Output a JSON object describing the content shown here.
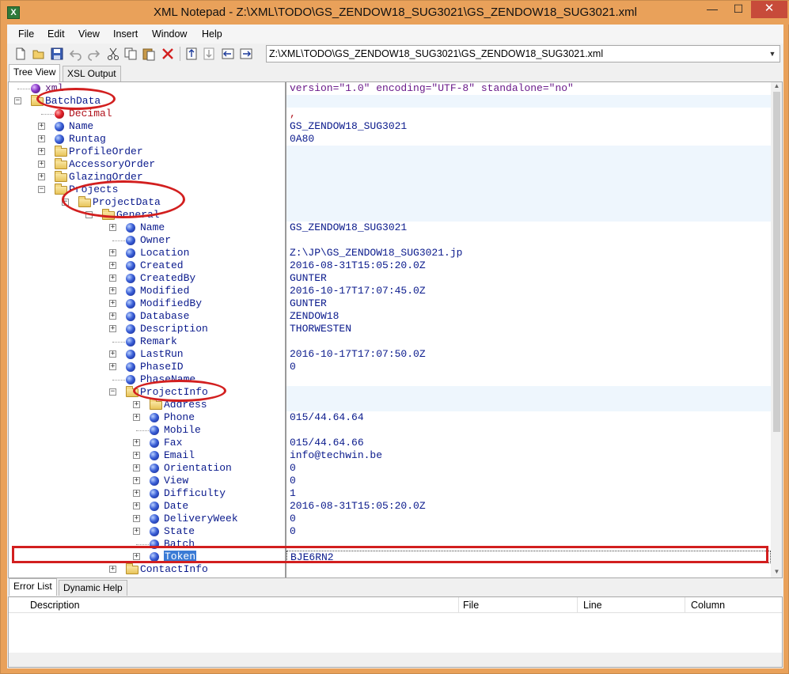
{
  "window": {
    "title": "XML Notepad - Z:\\XML\\TODO\\GS_ZENDOW18_SUG3021\\GS_ZENDOW18_SUG3021.xml",
    "icon_letter": "X",
    "minimize": "—",
    "maximize": "☐",
    "close": "✕"
  },
  "menu": [
    "File",
    "Edit",
    "View",
    "Insert",
    "Window",
    "Help"
  ],
  "toolbar": {
    "path": "Z:\\XML\\TODO\\GS_ZENDOW18_SUG3021\\GS_ZENDOW18_SUG3021.xml",
    "icons": [
      "new-file-icon",
      "open-folder-icon",
      "save-icon",
      "undo-icon",
      "redo-icon",
      "cut-icon",
      "copy-icon",
      "paste-icon",
      "delete-icon",
      "nudge-up-icon",
      "nudge-down-icon",
      "nudge-left-icon",
      "nudge-right-icon"
    ]
  },
  "tabs_top": [
    "Tree View",
    "XSL Output"
  ],
  "tree": [
    {
      "label": "xml",
      "type": "pi",
      "depth": 0,
      "expander": ""
    },
    {
      "label": "BatchData",
      "type": "folder",
      "depth": 0,
      "expander": "−"
    },
    {
      "label": "Decimal",
      "type": "attr",
      "depth": 1,
      "expander": ""
    },
    {
      "label": "Name",
      "type": "elem",
      "depth": 1,
      "expander": "+"
    },
    {
      "label": "Runtag",
      "type": "elem",
      "depth": 1,
      "expander": "+"
    },
    {
      "label": "ProfileOrder",
      "type": "folder",
      "depth": 1,
      "expander": "+"
    },
    {
      "label": "AccessoryOrder",
      "type": "folder",
      "depth": 1,
      "expander": "+"
    },
    {
      "label": "GlazingOrder",
      "type": "folder",
      "depth": 1,
      "expander": "+"
    },
    {
      "label": "Projects",
      "type": "folder",
      "depth": 1,
      "expander": "−"
    },
    {
      "label": "ProjectData",
      "type": "folder",
      "depth": 2,
      "expander": "−"
    },
    {
      "label": "General",
      "type": "folder",
      "depth": 3,
      "expander": "−"
    },
    {
      "label": "Name",
      "type": "elem",
      "depth": 4,
      "expander": "+"
    },
    {
      "label": "Owner",
      "type": "elem",
      "depth": 4,
      "expander": ""
    },
    {
      "label": "Location",
      "type": "elem",
      "depth": 4,
      "expander": "+"
    },
    {
      "label": "Created",
      "type": "elem",
      "depth": 4,
      "expander": "+"
    },
    {
      "label": "CreatedBy",
      "type": "elem",
      "depth": 4,
      "expander": "+"
    },
    {
      "label": "Modified",
      "type": "elem",
      "depth": 4,
      "expander": "+"
    },
    {
      "label": "ModifiedBy",
      "type": "elem",
      "depth": 4,
      "expander": "+"
    },
    {
      "label": "Database",
      "type": "elem",
      "depth": 4,
      "expander": "+"
    },
    {
      "label": "Description",
      "type": "elem",
      "depth": 4,
      "expander": "+"
    },
    {
      "label": "Remark",
      "type": "elem",
      "depth": 4,
      "expander": ""
    },
    {
      "label": "LastRun",
      "type": "elem",
      "depth": 4,
      "expander": "+"
    },
    {
      "label": "PhaseID",
      "type": "elem",
      "depth": 4,
      "expander": "+"
    },
    {
      "label": "PhaseName",
      "type": "elem",
      "depth": 4,
      "expander": ""
    },
    {
      "label": "ProjectInfo",
      "type": "folder",
      "depth": 4,
      "expander": "−"
    },
    {
      "label": "Address",
      "type": "folder",
      "depth": 5,
      "expander": "+"
    },
    {
      "label": "Phone",
      "type": "elem",
      "depth": 5,
      "expander": "+"
    },
    {
      "label": "Mobile",
      "type": "elem",
      "depth": 5,
      "expander": ""
    },
    {
      "label": "Fax",
      "type": "elem",
      "depth": 5,
      "expander": "+"
    },
    {
      "label": "Email",
      "type": "elem",
      "depth": 5,
      "expander": "+"
    },
    {
      "label": "Orientation",
      "type": "elem",
      "depth": 5,
      "expander": "+"
    },
    {
      "label": "View",
      "type": "elem",
      "depth": 5,
      "expander": "+"
    },
    {
      "label": "Difficulty",
      "type": "elem",
      "depth": 5,
      "expander": "+"
    },
    {
      "label": "Date",
      "type": "elem",
      "depth": 5,
      "expander": "+"
    },
    {
      "label": "DeliveryWeek",
      "type": "elem",
      "depth": 5,
      "expander": "+"
    },
    {
      "label": "State",
      "type": "elem",
      "depth": 5,
      "expander": "+"
    },
    {
      "label": "Batch",
      "type": "elem",
      "depth": 5,
      "expander": ""
    },
    {
      "label": "Token",
      "type": "elem",
      "depth": 5,
      "expander": "+",
      "selected": true
    },
    {
      "label": "ContactInfo",
      "type": "folder",
      "depth": 4,
      "expander": "+"
    }
  ],
  "values": [
    "version=\"1.0\" encoding=\"UTF-8\" standalone=\"no\"",
    "",
    ",",
    "GS_ZENDOW18_SUG3021",
    "0A80",
    "",
    "",
    "",
    "",
    "",
    "",
    "GS_ZENDOW18_SUG3021",
    "",
    "Z:\\JP\\GS_ZENDOW18_SUG3021.jp",
    "2016-08-31T15:05:20.0Z",
    "GUNTER",
    "2016-10-17T17:07:45.0Z",
    "GUNTER",
    "ZENDOW18",
    "THORWESTEN",
    "",
    "2016-10-17T17:07:50.0Z",
    "0",
    "",
    "",
    "",
    "015/44.64.64",
    "",
    "015/44.64.66",
    "info@techwin.be",
    "0",
    "0",
    "1",
    "2016-08-31T15:05:20.0Z",
    "0",
    "0",
    "",
    "BJE6RN2",
    ""
  ],
  "tabs_bottom": [
    "Error List",
    "Dynamic Help"
  ],
  "error_list": {
    "columns": [
      "Description",
      "File",
      "Line",
      "Column"
    ]
  },
  "colors": {
    "frame": "#e9a15a",
    "annotation": "#d21f1f",
    "selection": "#3a7bd5",
    "text_blue": "#0a1a8c"
  }
}
